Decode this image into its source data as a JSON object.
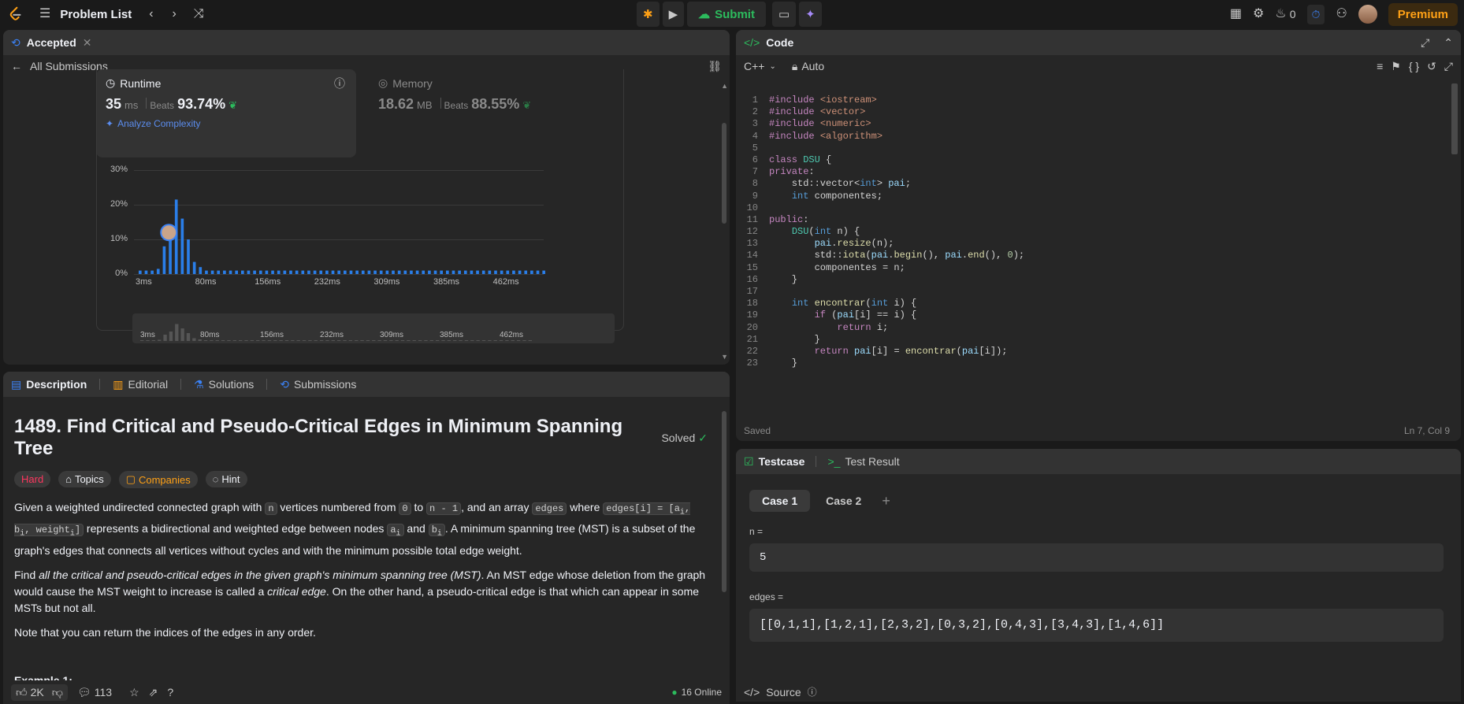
{
  "topbar": {
    "title": "Problem List",
    "submit": "Submit",
    "streak": "0",
    "premium": "Premium"
  },
  "submission": {
    "tab": "Accepted",
    "back": "All Submissions",
    "runtime": {
      "label": "Runtime",
      "value": "35",
      "unit": "ms",
      "beats_label": "Beats",
      "beats": "93.74%"
    },
    "memory": {
      "label": "Memory",
      "value": "18.62",
      "unit": "MB",
      "beats_label": "Beats",
      "beats": "88.55%"
    },
    "analyze": "Analyze Complexity"
  },
  "chart_data": {
    "type": "bar",
    "y_ticks": [
      "30%",
      "20%",
      "10%",
      "0%"
    ],
    "x_ticks": [
      "3ms",
      "80ms",
      "156ms",
      "232ms",
      "309ms",
      "385ms",
      "462ms"
    ],
    "ylim": [
      0,
      30
    ],
    "values": [
      1,
      1,
      1,
      1.5,
      8,
      12,
      21.5,
      16,
      10,
      3.5,
      2,
      1,
      1,
      1,
      1,
      1,
      1,
      1,
      1,
      1,
      1,
      1,
      1,
      1,
      1,
      1,
      1,
      1,
      1,
      1,
      1,
      1,
      1,
      1,
      1,
      1,
      1,
      1,
      1,
      1,
      1,
      1,
      1,
      1,
      1,
      1,
      1,
      1,
      1,
      1,
      1,
      1,
      1,
      1,
      1,
      1,
      1,
      1,
      1,
      1,
      1,
      1,
      1,
      1,
      1,
      1,
      1,
      1
    ],
    "highlight_value": 12,
    "colors": {
      "bar": "#2a7ee8",
      "grid": "#3a3a3a"
    }
  },
  "tabs": {
    "description": "Description",
    "editorial": "Editorial",
    "solutions": "Solutions",
    "submissions": "Submissions"
  },
  "problem": {
    "title": "1489. Find Critical and Pseudo-Critical Edges in Minimum Spanning Tree",
    "solved": "Solved",
    "difficulty": "Hard",
    "topics": "Topics",
    "companies": "Companies",
    "hint": "Hint",
    "p1_a": "Given a weighted undirected connected graph with ",
    "p1_n": "n",
    "p1_b": " vertices numbered from ",
    "p1_zero": "0",
    "p1_c": " to ",
    "p1_nm1": "n - 1",
    "p1_d": ", and an array ",
    "p1_edges": "edges",
    "p1_e": " where ",
    "p1_edgesi_1": "edges[i] = [a",
    "p1_edgesi_2": "b",
    "p1_edgesi_3": ", weight",
    "sub_i": "i",
    "p1_f": " represents a bidirectional and weighted edge between nodes ",
    "p1_ai": "a",
    "p1_g": " and ",
    "p1_bi": "b",
    "p1_h": ". A minimum spanning tree (MST) is a subset of the graph's edges that connects all vertices without cycles and with the minimum possible total edge weight.",
    "p2_a": "Find ",
    "p2_em": "all the critical and pseudo-critical edges in the given graph's minimum spanning tree (MST)",
    "p2_b": ". An MST edge whose deletion from the graph would cause the MST weight to increase is called a ",
    "p2_em2": "critical edge",
    "p2_c": ". On the other hand, a pseudo-critical edge is that which can appear in some MSTs but not all.",
    "p3": "Note that you can return the indices of the edges in any order.",
    "example": "Example 1:"
  },
  "footer": {
    "likes": "2K",
    "comments": "113",
    "online": "16 Online"
  },
  "code": {
    "title": "Code",
    "lang": "C++",
    "mode": "Auto",
    "saved": "Saved",
    "cursor": "Ln 7, Col 9",
    "lines": [
      "#include <iostream>",
      "#include <vector>",
      "#include <numeric>",
      "#include <algorithm>",
      "",
      "class DSU {",
      "private:",
      "    std::vector<int> pai;",
      "    int componentes;",
      "",
      "public:",
      "    DSU(int n) {",
      "        pai.resize(n);",
      "        std::iota(pai.begin(), pai.end(), 0);",
      "        componentes = n;",
      "    }",
      "",
      "    int encontrar(int i) {",
      "        if (pai[i] == i) {",
      "            return i;",
      "        }",
      "        return pai[i] = encontrar(pai[i]);",
      "    }"
    ]
  },
  "testcase": {
    "tab": "Testcase",
    "result_tab": "Test Result",
    "case1": "Case 1",
    "case2": "Case 2",
    "n_label": "n =",
    "n_value": "5",
    "edges_label": "edges =",
    "edges_value": "[[0,1,1],[1,2,1],[2,3,2],[0,3,2],[0,4,3],[3,4,3],[1,4,6]]",
    "source": "Source"
  }
}
